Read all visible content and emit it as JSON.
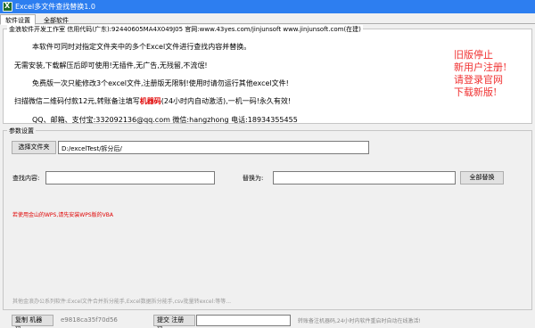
{
  "window": {
    "title": "Excel多文件查找替换1.0"
  },
  "tabs": [
    "软件设置",
    "全部软件"
  ],
  "info": {
    "group_title": "金浪软件开发工作室 信用代码(广东):92440605MA4X049J05 官网:www.43yes.com/jinjunsoft  www.jinjunsoft.com(在建)",
    "line1": "本软件可同时对指定文件夹中的多个Excel文件进行查找内容并替换。",
    "line2": "无需安装,下载解压后即可使用!无插件,无广告,无残留,不流氓!",
    "line3": "免费版一次只能修改3个excel文件,注册版无限制!使用时请勿运行其他excel文件!",
    "line4_a": "扫描微信二维码付款12元,转账备注填写",
    "line4_b": "机器码",
    "line4_c": "(24小时内自动激活),一机一码!永久有效!",
    "line5": "QQ、邮箱、支付宝:332092136@qq.com      微信:hangzhong      电话:18934355455",
    "notice": [
      "旧版停止",
      "新用户注册!",
      "请登录官网",
      "下载新版!"
    ]
  },
  "params": {
    "group_title": "参数设置",
    "choose_folder_button": "选择文件夹",
    "folder_path": "D:/excelTest/拆分后/",
    "find_label": "查找内容:",
    "find_value": "",
    "replace_label": "替换为:",
    "replace_value": "",
    "replace_all_button": "全部替换",
    "warning": "若使用金山的WPS,请先安装WPS版的VBA",
    "other_software": "其他金浪办公系列软件:Excel文件合并拆分能手,Excel数据拆分能手,csv批量转excel:等等..."
  },
  "statusbar": {
    "machine_code_label": "复制 机器码:",
    "machine_code": "e9818ca35f70d56",
    "submit_code_label": "提交 注册码:",
    "register_code": "",
    "hint": "转账备注机器码,24小时内软件重启时自动在线激活!"
  }
}
